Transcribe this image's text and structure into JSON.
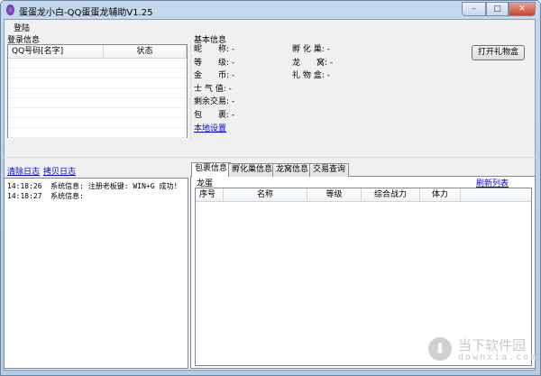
{
  "window": {
    "title": "蛋蛋龙小白-QQ蛋蛋龙辅助V1.25",
    "minimize": "–",
    "maximize": "□",
    "close": "✕"
  },
  "menu": [
    "登陆"
  ],
  "login": {
    "group": "登录信息",
    "columns": [
      "QQ号码[名字]",
      "状态"
    ],
    "rows": []
  },
  "basic": {
    "group": "基本信息",
    "left": [
      {
        "label": "昵　　称:",
        "value": "-"
      },
      {
        "label": "等　　级:",
        "value": "-"
      },
      {
        "label": "金　　币:",
        "value": "-"
      },
      {
        "label": "士 气 值:",
        "value": "-"
      },
      {
        "label": "剩余交易:",
        "value": "-"
      },
      {
        "label": "包　　裹:",
        "value": "-"
      }
    ],
    "right": [
      {
        "label": "孵 化 巢:",
        "value": "-"
      },
      {
        "label": "龙　　窝:",
        "value": "-"
      },
      {
        "label": "礼 物 盒:",
        "value": "-"
      }
    ],
    "settings_link": "本地设置",
    "open_gift_button": "打开礼物盒"
  },
  "log": {
    "clear": "清除日志",
    "copy": "拷贝日志",
    "entries": [
      {
        "time": "14:18:26",
        "text": "系统信息: 注册老板键: WIN+G 成功!"
      },
      {
        "time": "14:18:27",
        "text": "系统信息:"
      }
    ]
  },
  "tabs": [
    "包裹信息",
    "孵化巢信息",
    "龙窝信息",
    "交易查询"
  ],
  "bag": {
    "group": "龙蛋",
    "refresh": "刷新列表",
    "columns": [
      "序号",
      "名称",
      "等级",
      "综合战力",
      "体力"
    ],
    "rows": []
  },
  "watermark": {
    "name": "当下软件园",
    "url": "downxia.com"
  }
}
